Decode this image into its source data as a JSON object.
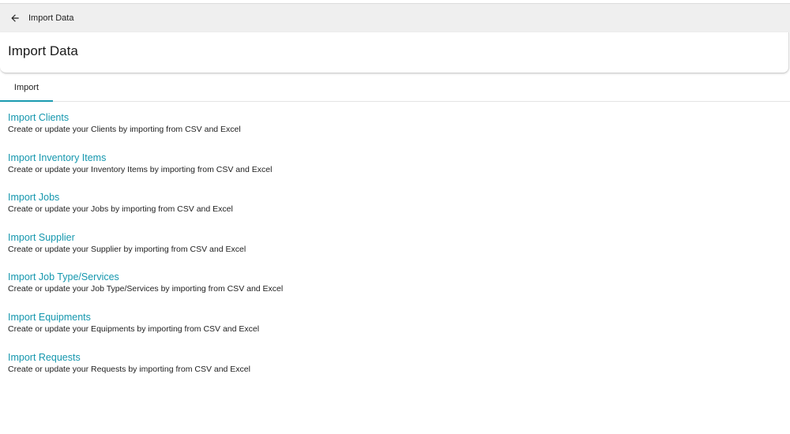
{
  "topbar": {
    "title": "Import Data",
    "back_icon": "arrow-left-icon"
  },
  "header": {
    "title": "Import Data"
  },
  "tabs": [
    {
      "label": "Import",
      "active": true
    }
  ],
  "colors": {
    "accent": "#1597ae",
    "topbar_bg": "#efefef"
  },
  "imports": [
    {
      "label": "Import Clients",
      "description": "Create or update your Clients by importing from CSV and Excel"
    },
    {
      "label": "Import Inventory Items",
      "description": "Create or update your Inventory Items by importing from CSV and Excel"
    },
    {
      "label": "Import Jobs",
      "description": "Create or update your Jobs by importing from CSV and Excel"
    },
    {
      "label": "Import Supplier",
      "description": "Create or update your Supplier by importing from CSV and Excel"
    },
    {
      "label": "Import Job Type/Services",
      "description": "Create or update your Job Type/Services by importing from CSV and Excel"
    },
    {
      "label": "Import Equipments",
      "description": "Create or update your Equipments by importing from CSV and Excel"
    },
    {
      "label": "Import Requests",
      "description": "Create or update your Requests by importing from CSV and Excel"
    }
  ]
}
